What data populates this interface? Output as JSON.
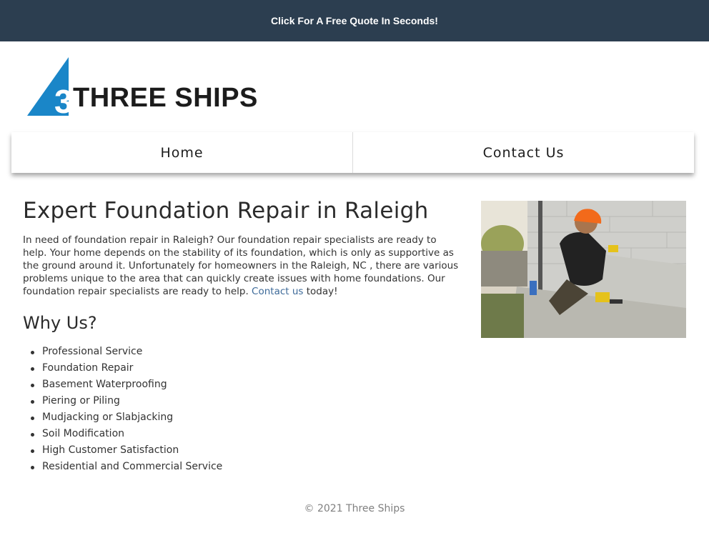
{
  "banner": {
    "cta_label": "Click For A Free Quote In Seconds!"
  },
  "logo": {
    "brand_text": "THREE SHIPS",
    "colors": {
      "sail": "#1a86c8",
      "text": "#1c1c1c"
    }
  },
  "nav": {
    "items": [
      {
        "label": "Home"
      },
      {
        "label": "Contact Us"
      }
    ]
  },
  "main": {
    "heading": "Expert Foundation Repair in Raleigh",
    "intro_text": "In need of foundation repair in Raleigh? Our foundation repair specialists are ready to help. Your home depends on the stability of its foundation, which is only as supportive as the ground around it. Unfortunately for homeowners in the Raleigh, NC , there are various problems unique to the area that can quickly create issues with home foundations. Our foundation repair specialists are ready to help. ",
    "contact_link": "Contact us",
    "intro_suffix": " today!",
    "why_heading": "Why Us?",
    "features": [
      "Professional Service",
      "Foundation Repair",
      "Basement Waterproofing",
      "Piering or Piling",
      "Mudjacking or Slabjacking",
      "Soil Modification",
      "High Customer Satisfaction",
      "Residential and Commercial Service"
    ]
  },
  "footer": {
    "copyright": "© 2021 Three Ships"
  },
  "colors": {
    "banner_bg": "#2c3e50",
    "link": "#3d6a99"
  }
}
